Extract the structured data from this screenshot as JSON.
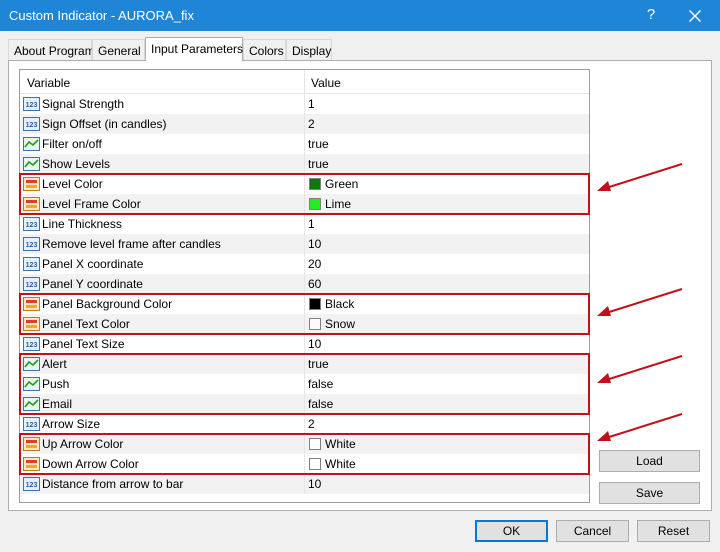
{
  "window": {
    "title": "Custom Indicator - AURORA_fix",
    "help": "?"
  },
  "tabs": [
    {
      "label": "About Program"
    },
    {
      "label": "General"
    },
    {
      "label": "Input Parameters",
      "active": true
    },
    {
      "label": "Colors"
    },
    {
      "label": "Display"
    }
  ],
  "grid": {
    "columns": {
      "variable": "Variable",
      "value": "Value"
    },
    "rows": [
      {
        "icon": "int",
        "name": "Signal Strength",
        "value": "1"
      },
      {
        "icon": "int",
        "name": "Sign Offset (in candles)",
        "value": "2"
      },
      {
        "icon": "bool",
        "name": "Filter on/off",
        "value": "true"
      },
      {
        "icon": "bool",
        "name": "Show Levels",
        "value": "true"
      },
      {
        "icon": "color",
        "name": "Level Color",
        "value": "Green",
        "swatch": "#0b7a0b"
      },
      {
        "icon": "color",
        "name": "Level Frame Color",
        "value": "Lime",
        "swatch": "#22ee22"
      },
      {
        "icon": "int",
        "name": "Line Thickness",
        "value": "1"
      },
      {
        "icon": "int",
        "name": "Remove level frame after candles",
        "value": "10"
      },
      {
        "icon": "int",
        "name": "Panel X coordinate",
        "value": "20"
      },
      {
        "icon": "int",
        "name": "Panel Y coordinate",
        "value": "60"
      },
      {
        "icon": "color",
        "name": "Panel Background Color",
        "value": "Black",
        "swatch": "#000000"
      },
      {
        "icon": "color",
        "name": "Panel Text Color",
        "value": "Snow",
        "swatch": "#fffafa"
      },
      {
        "icon": "int",
        "name": "Panel Text Size",
        "value": "10"
      },
      {
        "icon": "bool",
        "name": "Alert",
        "value": "true"
      },
      {
        "icon": "bool",
        "name": "Push",
        "value": "false"
      },
      {
        "icon": "bool",
        "name": "Email",
        "value": "false"
      },
      {
        "icon": "int",
        "name": "Arrow Size",
        "value": "2"
      },
      {
        "icon": "color",
        "name": "Up Arrow Color",
        "value": "White",
        "swatch": "#ffffff"
      },
      {
        "icon": "color",
        "name": "Down Arrow Color",
        "value": "White",
        "swatch": "#ffffff"
      },
      {
        "icon": "int",
        "name": "Distance from arrow to bar",
        "value": "10"
      }
    ]
  },
  "side_buttons": {
    "load": "Load",
    "save": "Save"
  },
  "footer_buttons": {
    "ok": "OK",
    "cancel": "Cancel",
    "reset": "Reset"
  },
  "colors": {
    "titlebar": "#1f86d7",
    "highlight": "#c0121a",
    "default_button_border": "#0078d7"
  }
}
